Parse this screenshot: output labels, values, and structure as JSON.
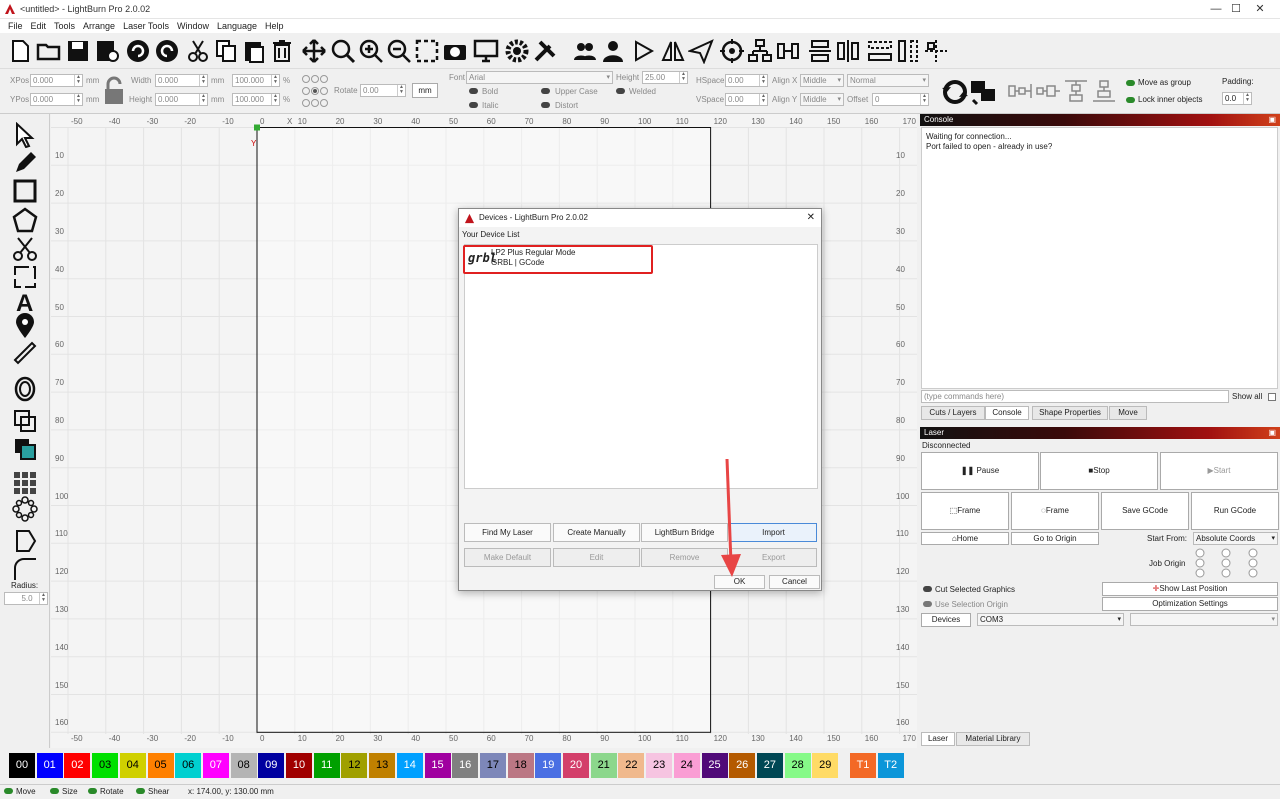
{
  "window": {
    "title": "<untitled> - LightBurn Pro 2.0.02",
    "minimize": "—",
    "maximize": "☐",
    "close": "✕"
  },
  "menu": [
    "File",
    "Edit",
    "Tools",
    "Arrange",
    "Laser Tools",
    "Window",
    "Language",
    "Help"
  ],
  "props": {
    "xpos_label": "XPos",
    "xpos": "0.000",
    "ypos_label": "YPos",
    "ypos": "0.000",
    "unit": "mm",
    "width_label": "Width",
    "width": "0.000",
    "height_label": "Height",
    "height": "0.000",
    "wpct": "100.000",
    "hpct": "100.000",
    "pct": "%",
    "rotate_label": "Rotate",
    "rotate": "0.00",
    "mm_btn": "mm",
    "font_label": "Font",
    "font": "Arial",
    "height2_label": "Height",
    "height2": "25.00",
    "bold": "Bold",
    "italic": "Italic",
    "upper": "Upper Case",
    "distort": "Distort",
    "welded": "Welded",
    "hspace_label": "HSpace",
    "hspace": "0.00",
    "vspace_label": "VSpace",
    "vspace": "0.00",
    "alignx_label": "Align X",
    "alignx": "Middle",
    "aligny_label": "Align Y",
    "aligny": "Middle",
    "normal": "Normal",
    "offset_label": "Offset",
    "offset": "0",
    "move_group": "Move as group",
    "lock_inner": "Lock inner objects",
    "padding_label": "Padding:",
    "padding": "0.0"
  },
  "left": {
    "radius_label": "Radius:",
    "radius": "5.0"
  },
  "ruler": {
    "top": [
      "-50",
      "-40",
      "-30",
      "-20",
      "-10",
      "0",
      "X",
      "10",
      "20",
      "30",
      "40",
      "50",
      "60",
      "70",
      "80",
      "90",
      "100",
      "110",
      "120",
      "130",
      "140",
      "150",
      "160",
      "170"
    ],
    "bottom": [
      "-50",
      "-40",
      "-30",
      "-20",
      "-10",
      "0",
      "10",
      "20",
      "30",
      "40",
      "50",
      "60",
      "70",
      "80",
      "90",
      "100",
      "110",
      "120",
      "130",
      "140",
      "150",
      "160",
      "170"
    ],
    "left": [
      "10",
      "20",
      "30",
      "40",
      "50",
      "60",
      "70",
      "80",
      "90",
      "100",
      "110",
      "120",
      "130",
      "140",
      "150",
      "160"
    ],
    "y_marker": "Y"
  },
  "console": {
    "title": "Console",
    "lines": [
      "Waiting for connection...",
      "Port failed to open - already in use?"
    ],
    "placeholder": "(type commands here)",
    "show_all": "Show all"
  },
  "tabs": [
    "Cuts / Layers",
    "Console",
    "Shape Properties",
    "Move"
  ],
  "laser": {
    "title": "Laser",
    "status": "Disconnected",
    "pause": "Pause",
    "stop": "Stop",
    "start": "Start",
    "frame1": "Frame",
    "frame2": "Frame",
    "save_gcode": "Save GCode",
    "run_gcode": "Run GCode",
    "home": "Home",
    "go_origin": "Go to Origin",
    "start_from_label": "Start From:",
    "start_from": "Absolute Coords",
    "job_origin": "Job Origin",
    "cut_selected": "Cut Selected Graphics",
    "use_sel_origin": "Use Selection Origin",
    "show_last": "Show Last Position",
    "opt_settings": "Optimization Settings",
    "devices": "Devices",
    "port": "COM3"
  },
  "bottom_tabs": [
    "Laser",
    "Material Library"
  ],
  "palette": [
    {
      "label": "00",
      "bg": "#000000",
      "fg": "#ffffff"
    },
    {
      "label": "01",
      "bg": "#0000ff",
      "fg": "#ffffff"
    },
    {
      "label": "02",
      "bg": "#ff0000",
      "fg": "#ffffff"
    },
    {
      "label": "03",
      "bg": "#00e000",
      "fg": "#000000"
    },
    {
      "label": "04",
      "bg": "#d0d000",
      "fg": "#000000"
    },
    {
      "label": "05",
      "bg": "#ff8000",
      "fg": "#000000"
    },
    {
      "label": "06",
      "bg": "#00d0d0",
      "fg": "#000000"
    },
    {
      "label": "07",
      "bg": "#ff00ff",
      "fg": "#ffffff"
    },
    {
      "label": "08",
      "bg": "#b4b4b4",
      "fg": "#000000"
    },
    {
      "label": "09",
      "bg": "#0000a0",
      "fg": "#ffffff"
    },
    {
      "label": "10",
      "bg": "#a00000",
      "fg": "#ffffff"
    },
    {
      "label": "11",
      "bg": "#00a000",
      "fg": "#ffffff"
    },
    {
      "label": "12",
      "bg": "#a0a000",
      "fg": "#000000"
    },
    {
      "label": "13",
      "bg": "#c08000",
      "fg": "#000000"
    },
    {
      "label": "14",
      "bg": "#00a0ff",
      "fg": "#ffffff"
    },
    {
      "label": "15",
      "bg": "#a000a0",
      "fg": "#ffffff"
    },
    {
      "label": "16",
      "bg": "#808080",
      "fg": "#ffffff"
    },
    {
      "label": "17",
      "bg": "#7d87b9",
      "fg": "#000000"
    },
    {
      "label": "18",
      "bg": "#bb7784",
      "fg": "#000000"
    },
    {
      "label": "19",
      "bg": "#4a6fe3",
      "fg": "#ffffff"
    },
    {
      "label": "20",
      "bg": "#d33f6a",
      "fg": "#ffffff"
    },
    {
      "label": "21",
      "bg": "#8cd78c",
      "fg": "#000000"
    },
    {
      "label": "22",
      "bg": "#f0b98d",
      "fg": "#000000"
    },
    {
      "label": "23",
      "bg": "#f6c4e1",
      "fg": "#000000"
    },
    {
      "label": "24",
      "bg": "#fa9ed4",
      "fg": "#000000"
    },
    {
      "label": "25",
      "bg": "#500a78",
      "fg": "#ffffff"
    },
    {
      "label": "26",
      "bg": "#b45a00",
      "fg": "#ffffff"
    },
    {
      "label": "27",
      "bg": "#004754",
      "fg": "#ffffff"
    },
    {
      "label": "28",
      "bg": "#86fa88",
      "fg": "#000000"
    },
    {
      "label": "29",
      "bg": "#ffdb66",
      "fg": "#000000"
    },
    {
      "label": "T1",
      "bg": "#f36926",
      "fg": "#ffffff"
    },
    {
      "label": "T2",
      "bg": "#0c96d9",
      "fg": "#ffffff"
    }
  ],
  "status": {
    "move": "Move",
    "size": "Size",
    "rotate": "Rotate",
    "shear": "Shear",
    "coords": "x: 174.00, y: 130.00 mm"
  },
  "dialog": {
    "title": "Devices - LightBurn Pro 2.0.02",
    "close": "✕",
    "list_label": "Your Device List",
    "device_logo": "grbl",
    "device_name": "LP2 Plus Regular Mode",
    "device_sub": "GRBL | GCode",
    "find": "Find My Laser",
    "create": "Create Manually",
    "bridge": "LightBurn Bridge",
    "import": "Import",
    "make_default": "Make Default",
    "edit": "Edit",
    "remove": "Remove",
    "export": "Export",
    "ok": "OK",
    "cancel": "Cancel",
    "highlight_color": "#e02020"
  }
}
